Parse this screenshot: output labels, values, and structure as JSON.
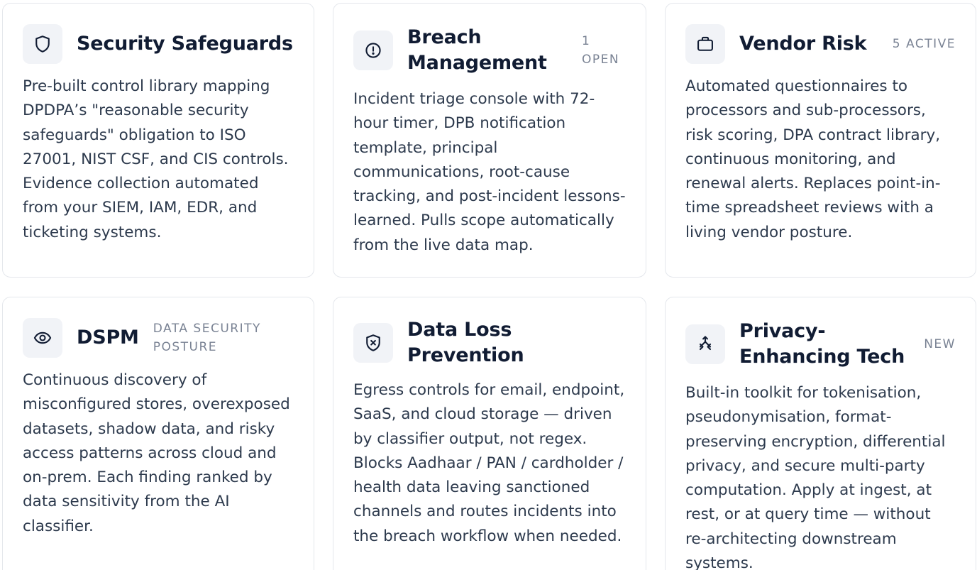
{
  "cards": [
    {
      "icon": "shield-icon",
      "title": "Security Safeguards",
      "badge": "",
      "description": "Pre-built control library mapping DPDPA’s \"reasonable security safeguards\" obligation to ISO 27001, NIST CSF, and CIS controls. Evidence collection automated from your SIEM, IAM, EDR, and ticketing systems."
    },
    {
      "icon": "alert-circle-icon",
      "title": "Breach Management",
      "badge": "1 OPEN",
      "description": "Incident triage console with 72-hour timer, DPB notification template, principal communications, root-cause tracking, and post-incident lessons-learned. Pulls scope automatically from the live data map."
    },
    {
      "icon": "briefcase-icon",
      "title": "Vendor Risk",
      "badge": "5 ACTIVE",
      "description": "Automated questionnaires to processors and sub-processors, risk scoring, DPA contract library, continuous monitoring, and renewal alerts. Replaces point-in-time spreadsheet reviews with a living vendor posture."
    },
    {
      "icon": "eye-icon",
      "title": "DSPM",
      "badge": "DATA SECURITY POSTURE",
      "description": "Continuous discovery of misconfigured stores, overexposed datasets, shadow data, and risky access patterns across cloud and on-prem. Each finding ranked by data sensitivity from the AI classifier."
    },
    {
      "icon": "shield-x-icon",
      "title": "Data Loss Prevention",
      "badge": "",
      "description": "Egress controls for email, endpoint, SaaS, and cloud storage — driven by classifier output, not regex. Blocks Aadhaar / PAN / cardholder / health data leaving sanctioned channels and routes incidents into the breach workflow when needed."
    },
    {
      "icon": "split-arrows-icon",
      "title": "Privacy-Enhancing Tech",
      "badge": "NEW",
      "description": "Built-in toolkit for tokenisation, pseudonymisation, format-preserving encryption, differential privacy, and secure multi-party computation. Apply at ingest, at rest, or at query time — without re-architecting downstream systems."
    }
  ],
  "colors": {
    "title": "#111c33",
    "text": "#2d3a4d",
    "badge": "#7a8394",
    "border": "#e4e7ec",
    "icon_bg": "#f1f3f7"
  }
}
